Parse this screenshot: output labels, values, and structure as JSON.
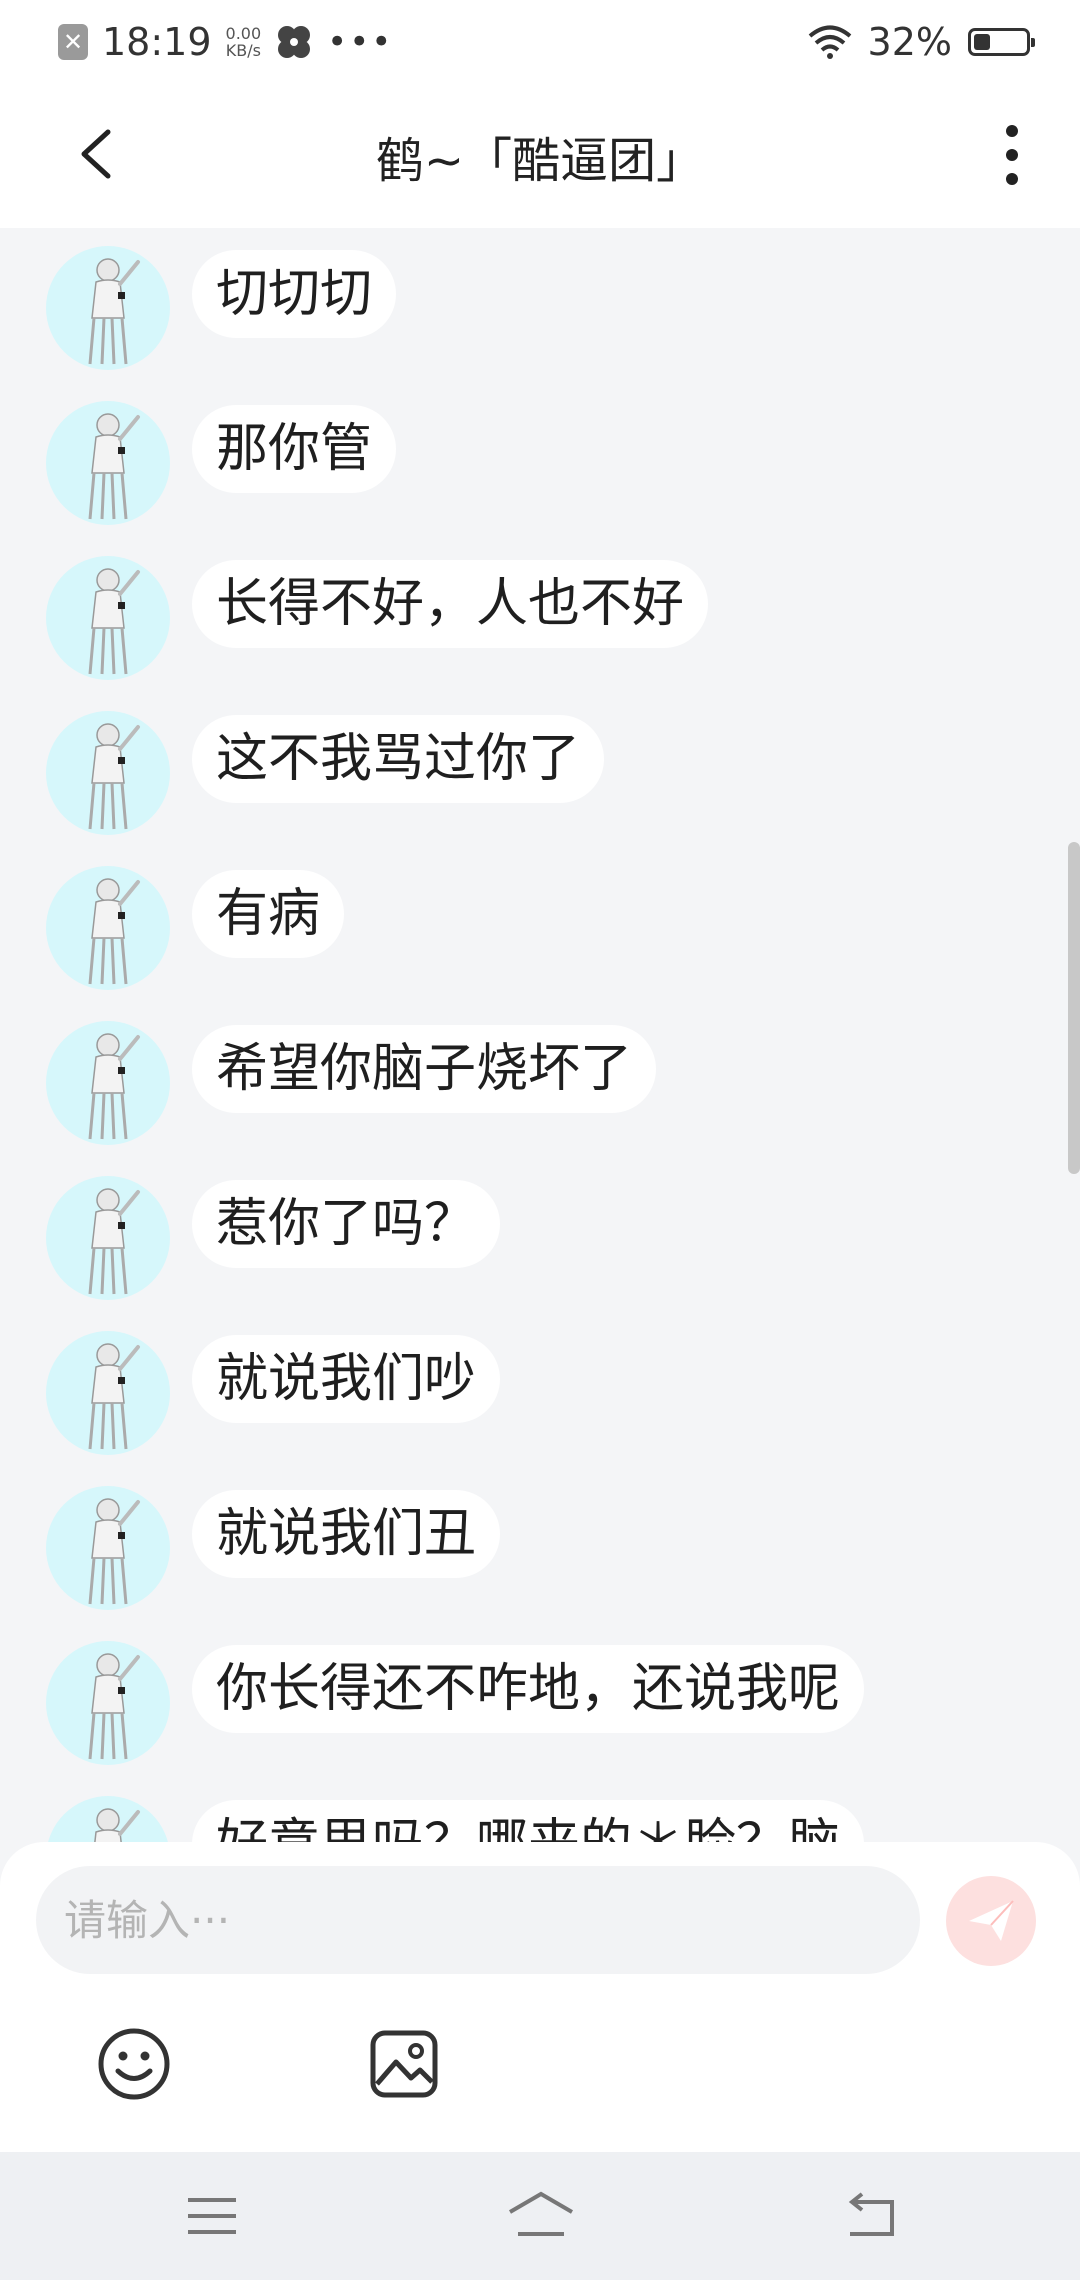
{
  "status_bar": {
    "time": "18:19",
    "net_speed_value": "0.00",
    "net_speed_unit": "KB/s",
    "battery_percent": "32%",
    "battery_level": 0.32,
    "icons": [
      "close-box-icon",
      "pinwheel-icon",
      "more-dots-icon",
      "wifi-icon",
      "battery-icon"
    ]
  },
  "header": {
    "title": "鹤~「酷逼团」",
    "back_icon": "chevron-left-icon",
    "more_icon": "vertical-dots-icon"
  },
  "messages": [
    {
      "text": "切切切"
    },
    {
      "text": "那你管"
    },
    {
      "text": "长得不好，人也不好"
    },
    {
      "text": "这不我骂过你了"
    },
    {
      "text": "有病"
    },
    {
      "text": "希望你脑子烧坏了"
    },
    {
      "text": "惹你了吗？"
    },
    {
      "text": "就说我们吵"
    },
    {
      "text": "就说我们丑"
    },
    {
      "text": "你长得还不咋地，还说我呢"
    },
    {
      "text": "好意思吗？哪来的＊脸？脑"
    }
  ],
  "composer": {
    "placeholder": "请输入···",
    "send_icon": "paper-plane-icon",
    "emoji_icon": "smiley-icon",
    "image_icon": "image-icon"
  },
  "nav_bar": {
    "icons": [
      "menu-icon",
      "home-icon",
      "back-icon"
    ]
  },
  "colors": {
    "background": "#f4f5f7",
    "bubble": "#ffffff",
    "avatar_bg": "#d6f7fb",
    "send_button": "#fde0df",
    "nav_bar": "#eef0f3"
  }
}
